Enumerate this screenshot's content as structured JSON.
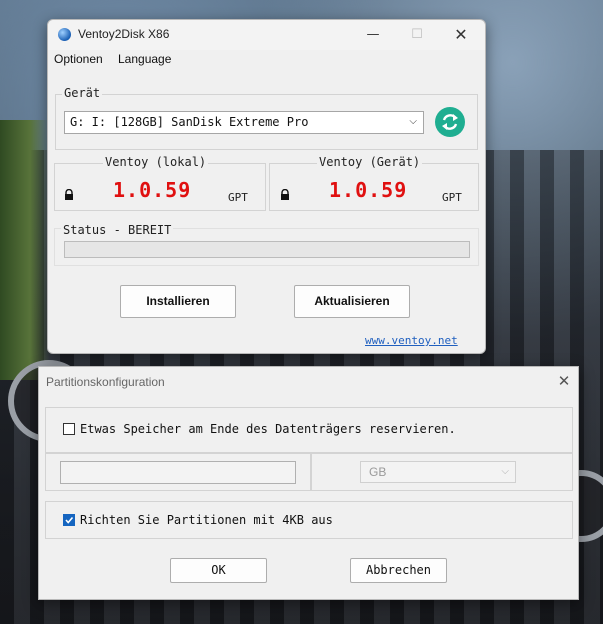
{
  "main_window": {
    "title": "Ventoy2Disk  X86",
    "controls": {
      "minimize": "—",
      "maximize": "☐",
      "close": "✕"
    },
    "menu": [
      "Optionen",
      "Language"
    ],
    "device_group": {
      "label": "Gerät",
      "selected_device": "G: I: [128GB] SanDisk Extreme Pro"
    },
    "local": {
      "label": "Ventoy (lokal)",
      "version": "1.0.59",
      "partition_style": "GPT"
    },
    "device": {
      "label": "Ventoy (Gerät)",
      "version": "1.0.59",
      "partition_style": "GPT"
    },
    "status": {
      "label": "Status - BEREIT",
      "progress": 0
    },
    "buttons": {
      "install": "Installieren",
      "update": "Aktualisieren"
    },
    "link": "www.ventoy.net"
  },
  "partition_dialog": {
    "title": "Partitionskonfiguration",
    "close": "✕",
    "reserve_space": {
      "label": "Etwas Speicher am Ende des Datenträgers reservieren.",
      "checked": false,
      "value": "",
      "unit": "GB"
    },
    "align_4kb": {
      "label": "Richten Sie Partitionen mit 4KB aus",
      "checked": true
    },
    "buttons": {
      "ok": "OK",
      "cancel": "Abbrechen"
    }
  }
}
